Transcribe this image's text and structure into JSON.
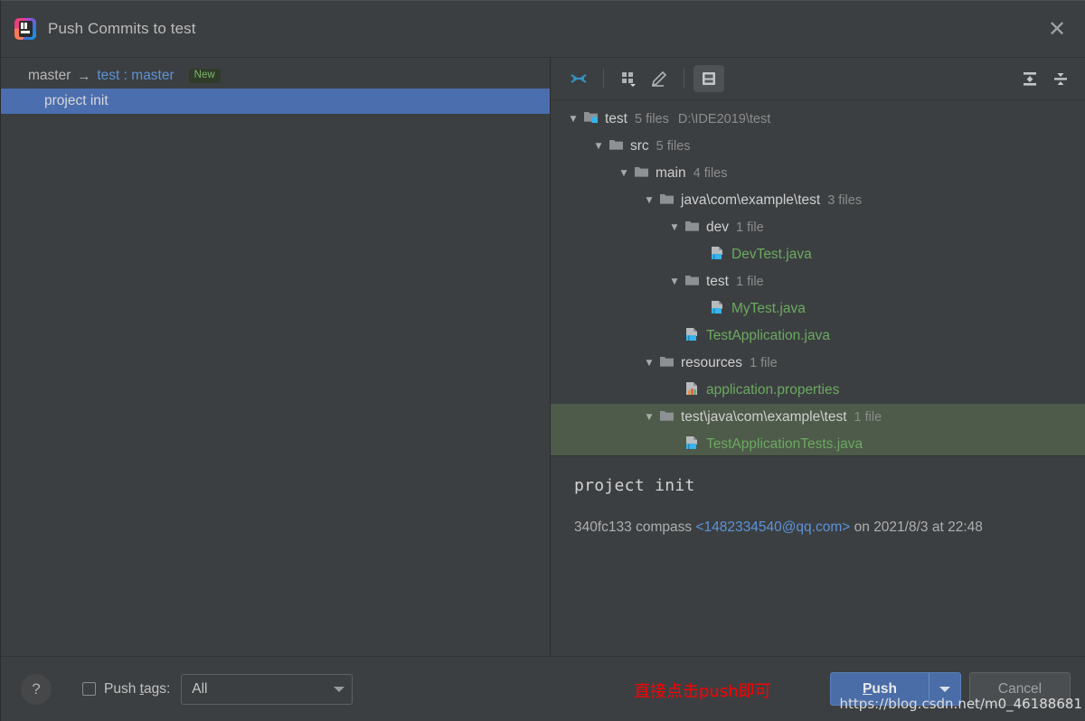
{
  "window": {
    "title": "Push Commits to test",
    "app_icon": "intellij-idea-icon",
    "close_icon": "close-icon"
  },
  "commits_panel": {
    "repo_row": {
      "source_branch": "master",
      "arrow": "→",
      "target_branch": "test : master",
      "badge": "New"
    },
    "commits": [
      {
        "subject": "project init",
        "selected": true
      }
    ]
  },
  "toolbar": {
    "buttons": [
      {
        "name": "show-diff-icon",
        "label": "Show Diff",
        "active": false
      },
      {
        "name": "group-by-icon",
        "label": "Group By",
        "active": false
      },
      {
        "name": "edit-source-icon",
        "label": "Edit Source",
        "active": false
      },
      {
        "name": "preview-diff-icon",
        "label": "Preview Diff",
        "active": true
      }
    ],
    "right_buttons": [
      {
        "name": "expand-all-icon",
        "label": "Expand All"
      },
      {
        "name": "collapse-all-icon",
        "label": "Collapse All"
      }
    ]
  },
  "file_tree": [
    {
      "indent": 0,
      "twisty": "▼",
      "icon": "folder-vcs-icon",
      "label": "test",
      "label_color": "default",
      "count": "5 files",
      "path": "D:\\IDE2019\\test",
      "highlight": false
    },
    {
      "indent": 1,
      "twisty": "▼",
      "icon": "folder-icon",
      "label": "src",
      "label_color": "default",
      "count": "5 files",
      "path": "",
      "highlight": false
    },
    {
      "indent": 2,
      "twisty": "▼",
      "icon": "folder-icon",
      "label": "main",
      "label_color": "default",
      "count": "4 files",
      "path": "",
      "highlight": false
    },
    {
      "indent": 3,
      "twisty": "▼",
      "icon": "folder-icon",
      "label": "java\\com\\example\\test",
      "label_color": "default",
      "count": "3 files",
      "path": "",
      "highlight": false
    },
    {
      "indent": 4,
      "twisty": "▼",
      "icon": "folder-icon",
      "label": "dev",
      "label_color": "default",
      "count": "1 file",
      "path": "",
      "highlight": false
    },
    {
      "indent": 5,
      "twisty": "",
      "icon": "java-file-icon",
      "label": "DevTest.java",
      "label_color": "green",
      "count": "",
      "path": "",
      "highlight": false
    },
    {
      "indent": 4,
      "twisty": "▼",
      "icon": "folder-icon",
      "label": "test",
      "label_color": "default",
      "count": "1 file",
      "path": "",
      "highlight": false
    },
    {
      "indent": 5,
      "twisty": "",
      "icon": "java-file-icon",
      "label": "MyTest.java",
      "label_color": "green",
      "count": "",
      "path": "",
      "highlight": false
    },
    {
      "indent": 4,
      "twisty": "",
      "icon": "java-file-icon",
      "label": "TestApplication.java",
      "label_color": "green",
      "count": "",
      "path": "",
      "highlight": false
    },
    {
      "indent": 3,
      "twisty": "▼",
      "icon": "folder-icon",
      "label": "resources",
      "label_color": "default",
      "count": "1 file",
      "path": "",
      "highlight": false
    },
    {
      "indent": 4,
      "twisty": "",
      "icon": "properties-file-icon",
      "label": "application.properties",
      "label_color": "green",
      "count": "",
      "path": "",
      "highlight": false
    },
    {
      "indent": 3,
      "twisty": "▼",
      "icon": "folder-icon",
      "label": "test\\java\\com\\example\\test",
      "label_color": "default",
      "count": "1 file",
      "path": "",
      "highlight": true
    },
    {
      "indent": 4,
      "twisty": "",
      "icon": "java-file-icon",
      "label": "TestApplicationTests.java",
      "label_color": "green",
      "count": "",
      "path": "",
      "highlight": true
    }
  ],
  "commit_detail": {
    "subject": "project init",
    "hash": "340fc133",
    "author": "compass",
    "email": "<1482334540@qq.com>",
    "on_word": "on",
    "date": "2021/8/3",
    "at_word": "at",
    "time": "22:48"
  },
  "footer": {
    "help_label": "?",
    "push_tags_label_pre": "Push ",
    "push_tags_label_mnemonic": "t",
    "push_tags_label_post": "ags:",
    "push_tags_checked": false,
    "tags_combo_value": "All",
    "annotation": "直接点击push即可",
    "push_label_mnemonic": "P",
    "push_label_rest": "ush",
    "cancel_label": "Cancel",
    "watermark": "https://blog.csdn.net/m0_46188681"
  },
  "colors": {
    "background": "#3C3F41",
    "selection_blue": "#4B6EAF",
    "tree_highlight": "#4E5A4A",
    "added_file_green": "#6BA961",
    "link_blue": "#5C93D8",
    "annotation_red": "#FF0000",
    "accent_icon_blue": "#3592C4"
  }
}
